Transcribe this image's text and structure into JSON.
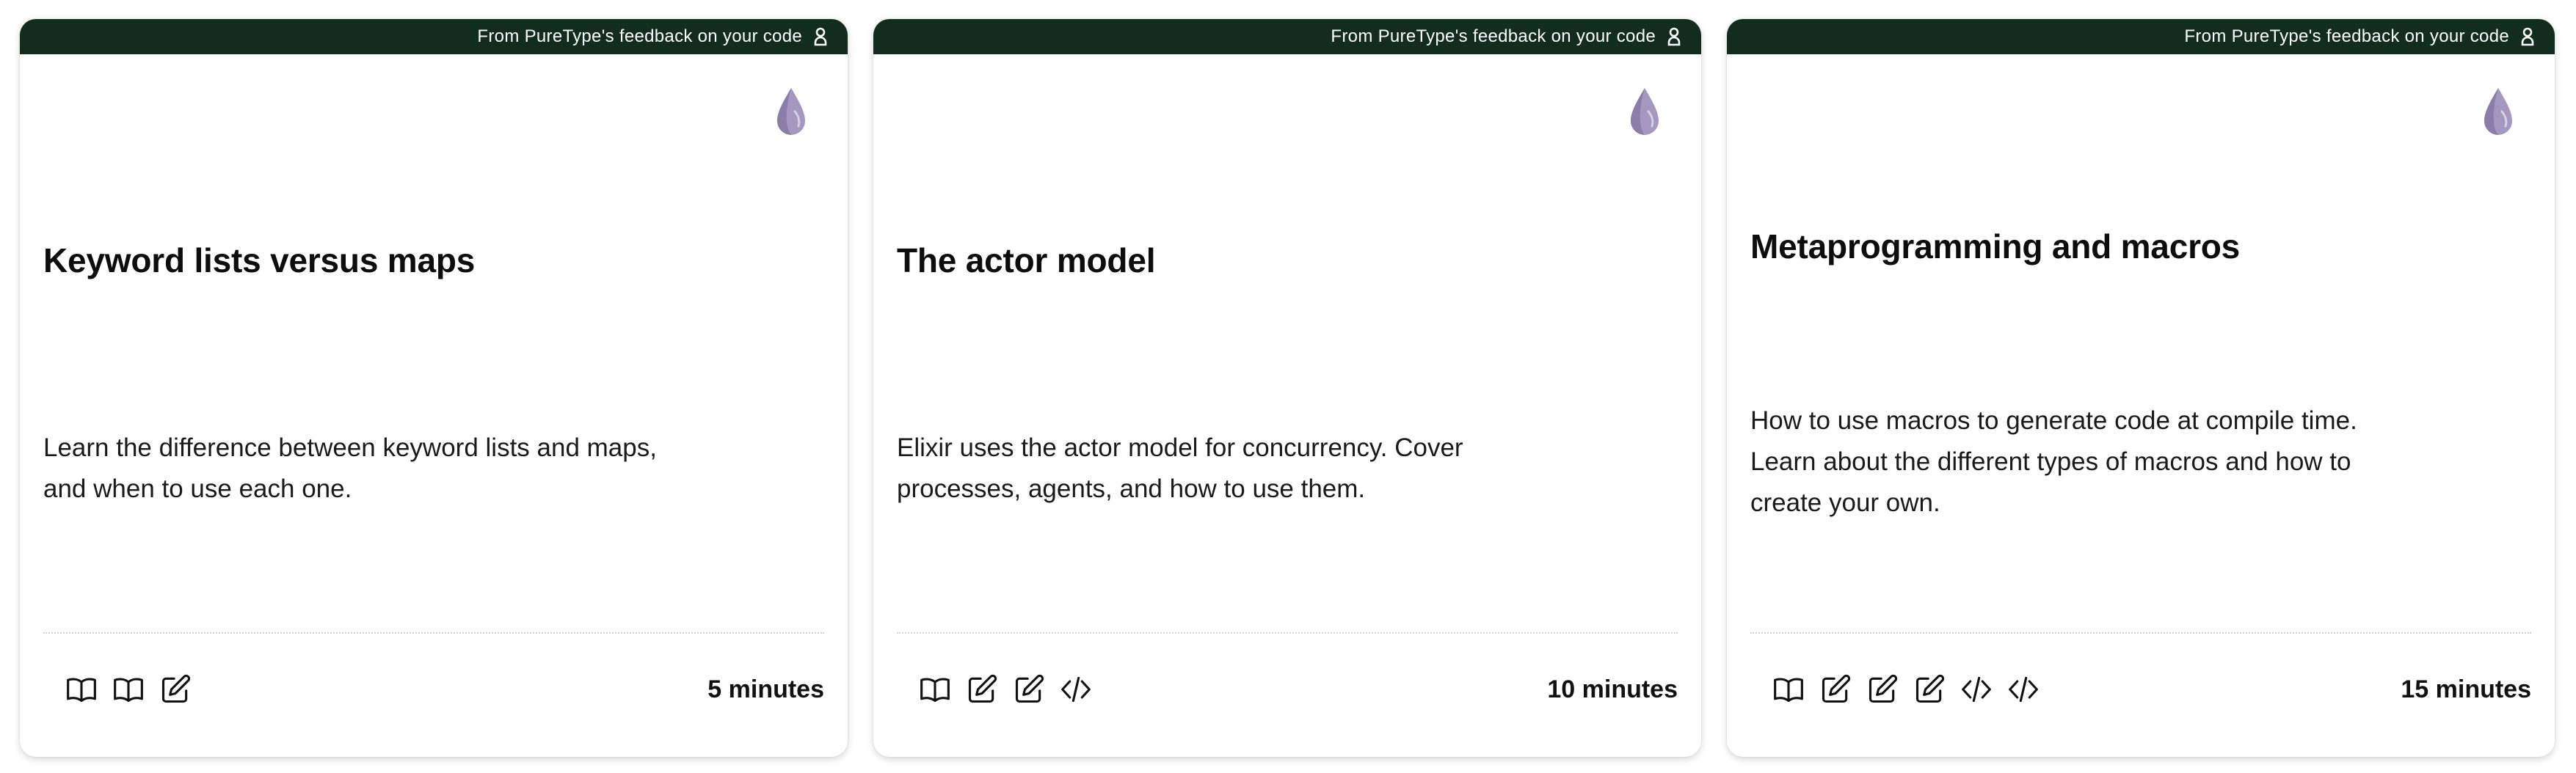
{
  "header_text": "From PureType's feedback on your code",
  "colors": {
    "header_bg": "#122d1f",
    "drop_icon": "#9b8fb3"
  },
  "cards": [
    {
      "title": "Keyword lists versus maps",
      "description": "Learn the difference between keyword lists and maps, and when to use each one.",
      "activities": [
        "book-open-icon",
        "book-open-icon",
        "pencil-square-icon"
      ],
      "duration": "5 minutes"
    },
    {
      "title": "The actor model",
      "description": "Elixir uses the actor model for concurrency. Cover processes, agents, and how to use them.",
      "activities": [
        "book-open-icon",
        "pencil-square-icon",
        "pencil-square-icon",
        "code-brackets-icon"
      ],
      "duration": "10 minutes"
    },
    {
      "title": "Metaprogramming and macros",
      "description": "How to use macros to generate code at compile time. Learn about the different types of macros and how to create your own.",
      "activities": [
        "book-open-icon",
        "pencil-square-icon",
        "pencil-square-icon",
        "pencil-square-icon",
        "code-brackets-icon",
        "code-brackets-icon"
      ],
      "duration": "15 minutes"
    }
  ]
}
